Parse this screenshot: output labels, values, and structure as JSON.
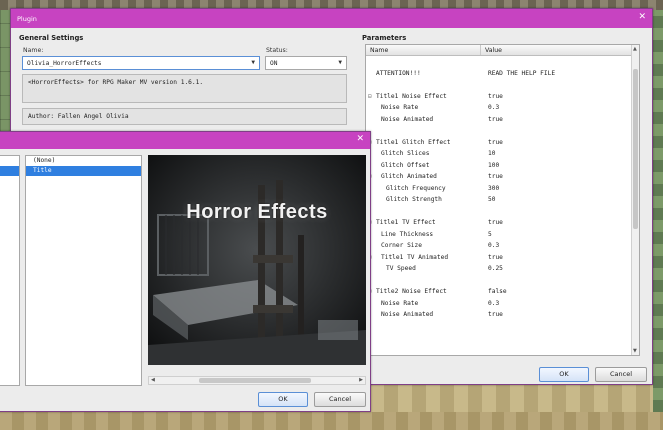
{
  "plugin_window": {
    "title": "Plugin",
    "general_settings": {
      "heading": "General Settings",
      "name_label": "Name:",
      "name_value": "Olivia_HorrorEffects",
      "status_label": "Status:",
      "status_value": "ON",
      "description": "<HorrorEffects> for RPG Maker MV version 1.6.1.",
      "author": "Author: Fallen Angel Olivia"
    },
    "parameters": {
      "heading": "Parameters",
      "col_name": "Name",
      "col_value": "Value",
      "rows": [
        {
          "name": "",
          "value": "",
          "toggle": ""
        },
        {
          "name": "ATTENTION!!!",
          "value": "READ THE HELP FILE",
          "toggle": ""
        },
        {
          "name": "",
          "value": "",
          "toggle": ""
        },
        {
          "name": "Title1 Noise Effect",
          "value": "true",
          "toggle": "⊟"
        },
        {
          "name": "Noise Rate",
          "value": "0.3",
          "toggle": "",
          "indent": 1
        },
        {
          "name": "Noise Animated",
          "value": "true",
          "toggle": "",
          "indent": 1
        },
        {
          "name": "",
          "value": "",
          "toggle": ""
        },
        {
          "name": "Title1 Glitch Effect",
          "value": "true",
          "toggle": "⊟"
        },
        {
          "name": "Glitch Slices",
          "value": "10",
          "toggle": "",
          "indent": 1
        },
        {
          "name": "Glitch Offset",
          "value": "100",
          "toggle": "",
          "indent": 1
        },
        {
          "name": "Glitch Animated",
          "value": "true",
          "toggle": "⊟",
          "indent": 1
        },
        {
          "name": "Glitch Frequency",
          "value": "300",
          "toggle": "",
          "indent": 2
        },
        {
          "name": "Glitch Strength",
          "value": "50",
          "toggle": "",
          "indent": 2
        },
        {
          "name": "",
          "value": "",
          "toggle": ""
        },
        {
          "name": "Title1 TV Effect",
          "value": "true",
          "toggle": "⊟"
        },
        {
          "name": "Line Thickness",
          "value": "5",
          "toggle": "",
          "indent": 1
        },
        {
          "name": "Corner Size",
          "value": "0.3",
          "toggle": "",
          "indent": 1
        },
        {
          "name": "Title1 TV Animated",
          "value": "true",
          "toggle": "⊟",
          "indent": 1
        },
        {
          "name": "TV Speed",
          "value": "0.25",
          "toggle": "",
          "indent": 2
        },
        {
          "name": "",
          "value": "",
          "toggle": ""
        },
        {
          "name": "Title2 Noise Effect",
          "value": "false",
          "toggle": "⊟"
        },
        {
          "name": "Noise Rate",
          "value": "0.3",
          "toggle": "",
          "indent": 1
        },
        {
          "name": "Noise Animated",
          "value": "true",
          "toggle": "",
          "indent": 1
        }
      ]
    },
    "ok_label": "OK",
    "cancel_label": "Cancel"
  },
  "image_picker": {
    "folders": [
      "",
      "",
      "",
      "",
      "",
      "",
      "",
      "",
      "",
      "",
      "",
      "",
      "",
      "",
      "",
      "",
      "",
      "",
      "",
      "",
      ""
    ],
    "files": [
      {
        "label": "(None)",
        "selected": false
      },
      {
        "label": "Title",
        "selected": true
      }
    ],
    "preview_title": "Horror Effects",
    "ok_label": "OK",
    "cancel_label": "Cancel"
  },
  "colors": {
    "titlebar": "#c743c1",
    "selection": "#2f7fe0"
  }
}
